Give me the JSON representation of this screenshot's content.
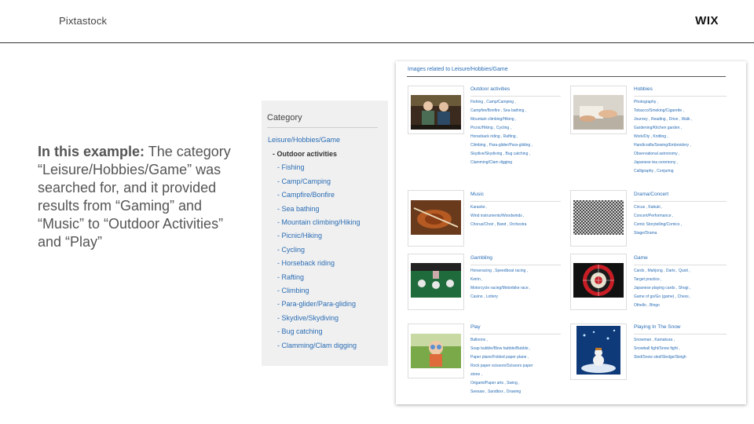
{
  "header": {
    "brand": "Pixtastock",
    "logo": "WIX"
  },
  "description": {
    "lead": "In this example:",
    "text": " The category “Leisure/Hobbies/Game” was searched for, and it provided results from “Gaming” and “Music” to “Outdoor Activities” and “Play”"
  },
  "category_panel": {
    "title": "Category",
    "root": "Leisure/Hobbies/Game",
    "items": [
      {
        "label": "- Outdoor activities",
        "active": true
      },
      {
        "label": "- Fishing"
      },
      {
        "label": "- Camp/Camping"
      },
      {
        "label": "- Campfire/Bonfire"
      },
      {
        "label": "- Sea bathing"
      },
      {
        "label": "- Mountain climbing/Hiking"
      },
      {
        "label": "- Picnic/Hiking"
      },
      {
        "label": "- Cycling"
      },
      {
        "label": "- Horseback riding"
      },
      {
        "label": "- Rafting"
      },
      {
        "label": "- Climbing"
      },
      {
        "label": "- Para-glider/Para-gliding"
      },
      {
        "label": "- Skydive/Skydiving"
      },
      {
        "label": "- Bug catching"
      },
      {
        "label": "- Clamming/Clam digging"
      }
    ]
  },
  "results_panel": {
    "title": "Images related to Leisure/Hobbies/Game",
    "groups": [
      {
        "title": "Outdoor activities",
        "lines": [
          "Fishing ,  Camp/Camping ,",
          "Campfire/Bonfire ,  Sea bathing ,",
          "Mountain climbing/Hiking ,",
          "Picnic/Hiking ,  Cycling ,",
          "Horseback riding ,  Rafting ,",
          "Climbing ,  Para-glider/Para-gliding ,",
          "Skydive/Skydiving ,  Bug catching ,",
          "Clamming/Clam digging"
        ]
      },
      {
        "title": "Hobbies",
        "lines": [
          "Photography ,",
          "Tobacco/Smoking/Cigarette ,",
          "Journey ,  Reading ,  Drive ,  Walk ,",
          "Gardening/Kitchen garden ,",
          "Work/Diy ,  Knitting ,",
          "Handicrafts/Sewing/Embroidery ,",
          "Observational astronomy ,",
          "Japanese tea ceremony ,",
          "Calligraphy ,  Conjuring"
        ]
      },
      {
        "title": "Music",
        "lines": [
          "Karaoke ,",
          "Wind instruments/Woodwinds ,",
          "Chorus/Choir ,  Band ,  Orchestra"
        ]
      },
      {
        "title": "Drama/Concert",
        "lines": [
          "Circus ,  Kabuki ,",
          "Concert/Performance ,",
          "Comic Storytelling/Comics ,",
          "Stage/Drama"
        ]
      },
      {
        "title": "Gambling",
        "lines": [
          "Horseracing ,  Speedboat racing ,",
          "Keirin ,",
          "Motorcycle racing/Motorbike race ,",
          "Casino ,  Lottery"
        ]
      },
      {
        "title": "Game",
        "lines": [
          "Cards ,  Mahjong ,  Darts ,  Quoit ,",
          "Target practice ,",
          "Japanese playing cards ,  Shogi ,",
          "Game of go/Go (game) ,  Chess ,",
          "Othello ,  Bingo"
        ]
      },
      {
        "title": "Play",
        "lines": [
          "Balloons ,",
          "Soap bubble/Blow bubble/Bubble ,",
          "Paper plane/Folded paper plane ,",
          "Rock paper scissors/Scissors paper",
          "stone ,",
          "Origami/Paper arts ,  Swing ,",
          "Seesaw ,  Sandbox ,  Drawing"
        ]
      },
      {
        "title": "Playing In The Snow",
        "lines": [
          "Snowman ,  Kamakura ,",
          "Snowball fight/Snow fight ,",
          "Sled/Snow sled/Sledge/Sleigh"
        ]
      }
    ]
  },
  "colors": {
    "link": "#2a6db5",
    "panel_bg": "#f0f0f0"
  }
}
